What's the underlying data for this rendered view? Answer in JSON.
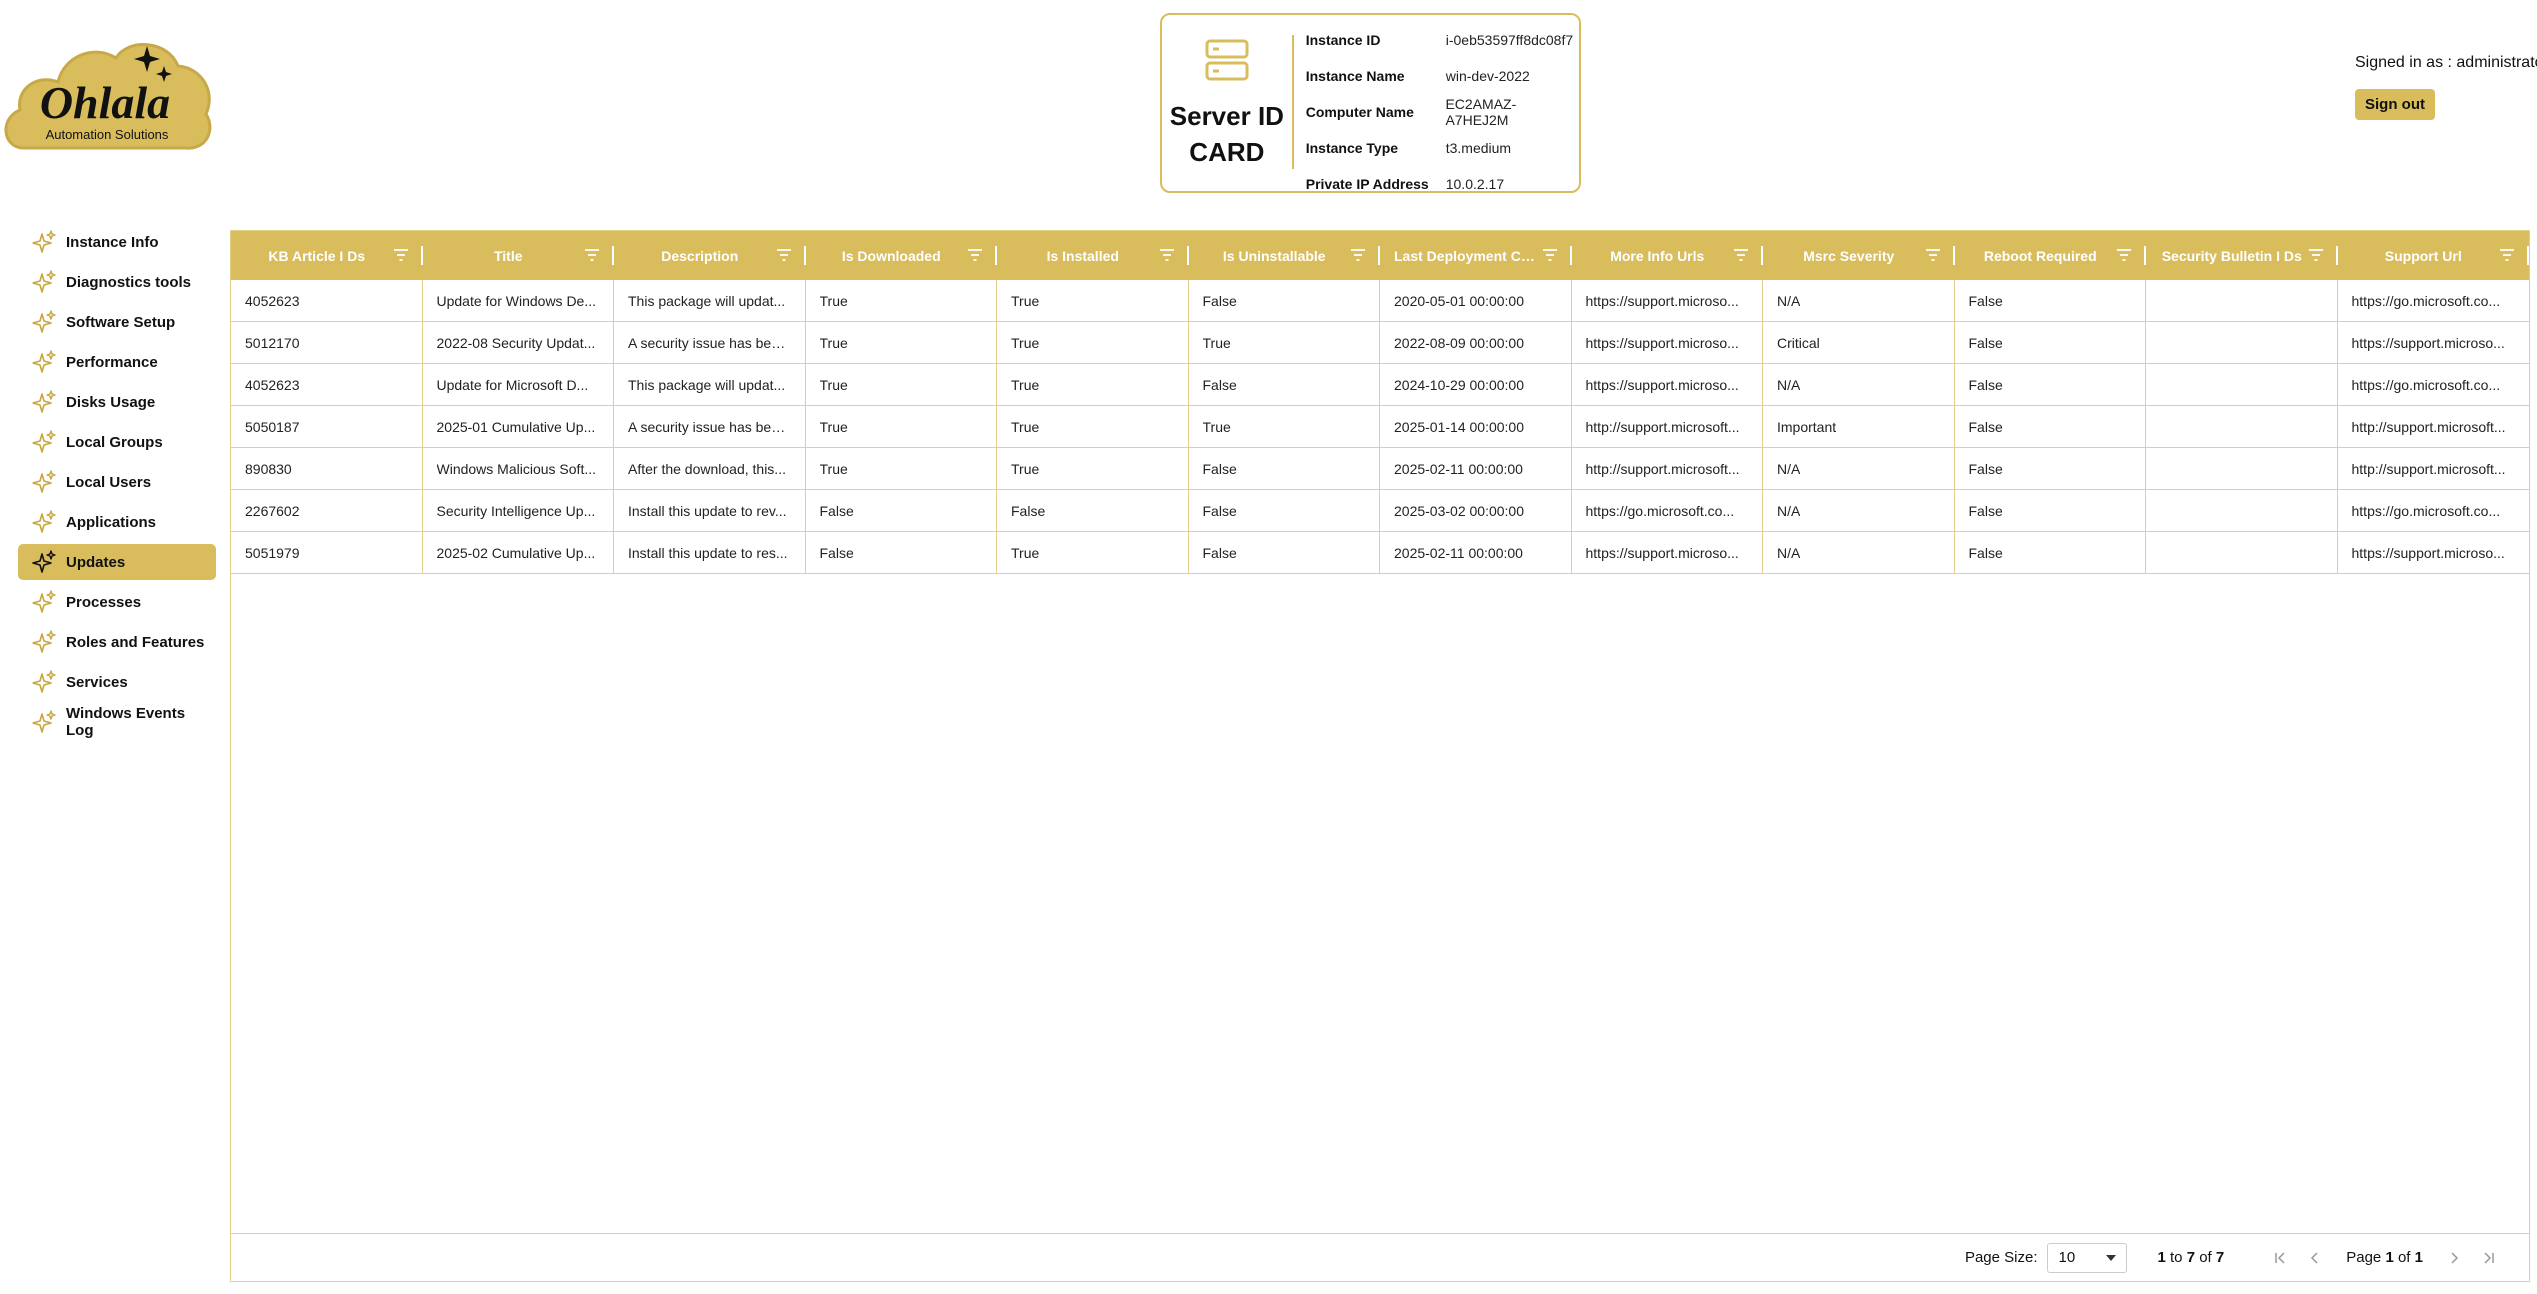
{
  "logo": {
    "brand": "Ohlala",
    "tagline": "Automation Solutions"
  },
  "id_card": {
    "title_line1": "Server ID",
    "title_line2": "CARD",
    "rows": [
      {
        "label": "Instance ID",
        "value": "i-0eb53597ff8dc08f7"
      },
      {
        "label": "Instance Name",
        "value": "win-dev-2022"
      },
      {
        "label": "Computer Name",
        "value": "EC2AMAZ-A7HEJ2M"
      },
      {
        "label": "Instance Type",
        "value": "t3.medium"
      },
      {
        "label": "Private IP Address",
        "value": "10.0.2.17"
      }
    ]
  },
  "session": {
    "signed_in_text": "Signed in as : administrator",
    "sign_out_label": "Sign out"
  },
  "sidebar": {
    "items": [
      {
        "label": "Instance Info",
        "active": false
      },
      {
        "label": "Diagnostics tools",
        "active": false
      },
      {
        "label": "Software Setup",
        "active": false
      },
      {
        "label": "Performance",
        "active": false
      },
      {
        "label": "Disks Usage",
        "active": false
      },
      {
        "label": "Local Groups",
        "active": false
      },
      {
        "label": "Local Users",
        "active": false
      },
      {
        "label": "Applications",
        "active": false
      },
      {
        "label": "Updates",
        "active": true
      },
      {
        "label": "Processes",
        "active": false
      },
      {
        "label": "Roles and Features",
        "active": false
      },
      {
        "label": "Services",
        "active": false
      },
      {
        "label": "Windows Events Log",
        "active": false
      }
    ]
  },
  "grid": {
    "columns": [
      "KB Article I Ds",
      "Title",
      "Description",
      "Is Downloaded",
      "Is Installed",
      "Is Uninstallable",
      "Last Deployment Ch...",
      "More Info Urls",
      "Msrc Severity",
      "Reboot Required",
      "Security Bulletin I Ds",
      "Support Url"
    ],
    "rows": [
      [
        "4052623",
        "Update for Windows De...",
        "This package will updat...",
        "True",
        "True",
        "False",
        "2020-05-01 00:00:00",
        "https://support.microso...",
        "N/A",
        "False",
        "",
        "https://go.microsoft.co..."
      ],
      [
        "5012170",
        "2022-08 Security Updat...",
        "A security issue has bee...",
        "True",
        "True",
        "True",
        "2022-08-09 00:00:00",
        "https://support.microso...",
        "Critical",
        "False",
        "",
        "https://support.microso..."
      ],
      [
        "4052623",
        "Update for Microsoft D...",
        "This package will updat...",
        "True",
        "True",
        "False",
        "2024-10-29 00:00:00",
        "https://support.microso...",
        "N/A",
        "False",
        "",
        "https://go.microsoft.co..."
      ],
      [
        "5050187",
        "2025-01 Cumulative Up...",
        "A security issue has bee...",
        "True",
        "True",
        "True",
        "2025-01-14 00:00:00",
        "http://support.microsoft...",
        "Important",
        "False",
        "",
        "http://support.microsoft..."
      ],
      [
        "890830",
        "Windows Malicious Soft...",
        "After the download, this...",
        "True",
        "True",
        "False",
        "2025-02-11 00:00:00",
        "http://support.microsoft...",
        "N/A",
        "False",
        "",
        "http://support.microsoft..."
      ],
      [
        "2267602",
        "Security Intelligence Up...",
        "Install this update to rev...",
        "False",
        "False",
        "False",
        "2025-03-02 00:00:00",
        "https://go.microsoft.co...",
        "N/A",
        "False",
        "",
        "https://go.microsoft.co..."
      ],
      [
        "5051979",
        "2025-02 Cumulative Up...",
        "Install this update to res...",
        "False",
        "True",
        "False",
        "2025-02-11 00:00:00",
        "https://support.microso...",
        "N/A",
        "False",
        "",
        "https://support.microso..."
      ]
    ]
  },
  "pagination": {
    "page_size_label": "Page Size:",
    "page_size": "10",
    "row_from": "1",
    "row_to_word": "to",
    "row_to": "7",
    "of_word": "of",
    "row_total": "7",
    "page_word": "Page",
    "page_current": "1",
    "page_total": "1"
  },
  "colors": {
    "accent": "#d9bd5c",
    "border": "#e4d08a"
  },
  "icons": {
    "nav": "sparkle-icon",
    "card": "server-icon",
    "filter": "filter-icon"
  }
}
